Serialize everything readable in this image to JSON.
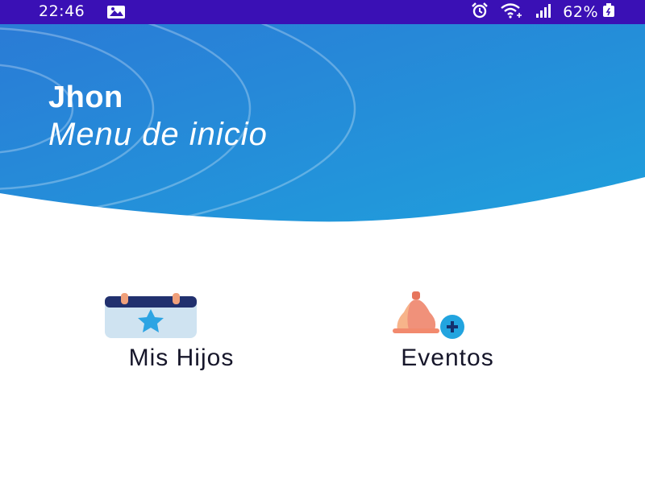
{
  "status_bar": {
    "time": "22:46",
    "battery": "62%",
    "icons": [
      "image-icon",
      "alarm-icon",
      "wifi-icon",
      "signal-icon",
      "battery-icon"
    ],
    "background": "#3a10b5"
  },
  "header": {
    "user_name": "Jhon",
    "title": "Menu de inicio",
    "gradient": [
      "#2a7bd6",
      "#1fa0dc"
    ]
  },
  "menu": {
    "items": [
      {
        "label": "Mis Hijos",
        "icon": "calendar-star-icon"
      },
      {
        "label": "Eventos",
        "icon": "bell-add-icon"
      }
    ]
  }
}
